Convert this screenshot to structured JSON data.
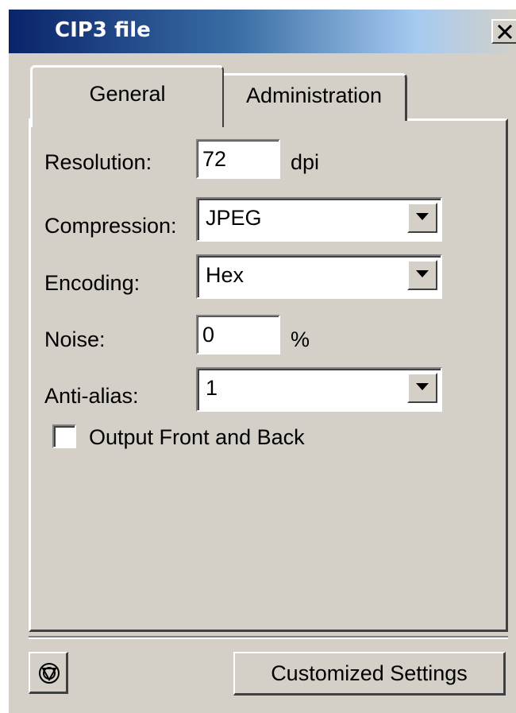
{
  "window": {
    "title": "CIP3 file",
    "close_symbol": "✕"
  },
  "tabs": [
    {
      "label": "General",
      "active": true
    },
    {
      "label": "Administration",
      "active": false
    }
  ],
  "form": {
    "resolution": {
      "label": "Resolution:",
      "value": "72",
      "unit": "dpi"
    },
    "compression": {
      "label": "Compression:",
      "value": "JPEG"
    },
    "encoding": {
      "label": "Encoding:",
      "value": "Hex"
    },
    "noise": {
      "label": "Noise:",
      "value": "0",
      "unit": "%"
    },
    "anti_alias": {
      "label": "Anti-alias:",
      "value": "1"
    },
    "output_front_back": {
      "label": "Output Front and Back",
      "checked": false
    }
  },
  "buttons": {
    "icon_button_icon": "target-icon",
    "customized_settings": "Customized Settings"
  },
  "colors": {
    "title_bar_start": "#0a246a",
    "title_bar_end": "#a6caf0",
    "dialog_bg": "#d4d0c8"
  }
}
